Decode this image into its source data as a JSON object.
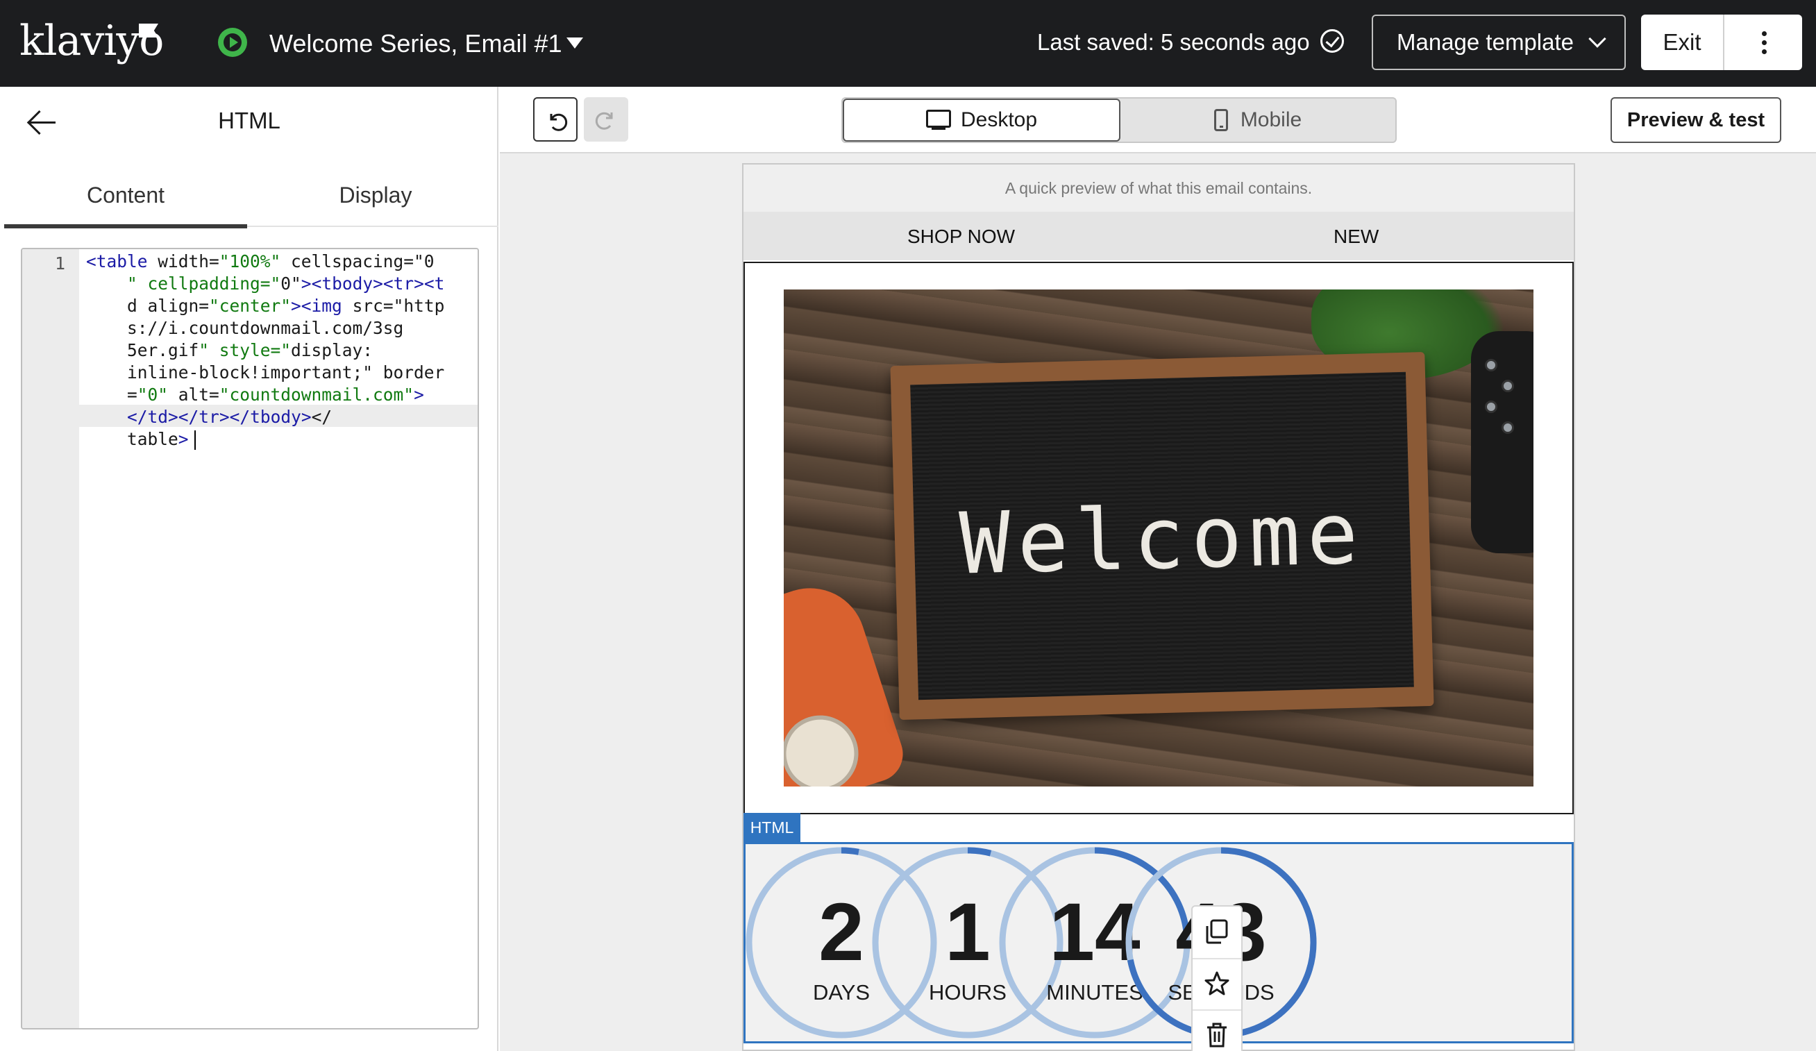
{
  "app": {
    "logo": "klaviyo",
    "brand_color": "#1c1d1f",
    "accent": "#2f74c0",
    "status_color": "#3fb54a"
  },
  "header": {
    "campaign_title": "Welcome Series, Email #1",
    "last_saved": "Last saved: 5 seconds ago",
    "manage_template_label": "Manage template",
    "exit_label": "Exit"
  },
  "left_panel": {
    "title": "HTML",
    "tabs": [
      {
        "label": "Content",
        "active": true
      },
      {
        "label": "Display",
        "active": false
      }
    ],
    "editor": {
      "line_number": "1",
      "code": "<table width=\"100%\" cellspacing=\"0\" cellpadding=\"0\"><tbody><tr><td align=\"center\"><img src=\"https://i.countdownmail.com/3sg5er.gif\" style=\"display:inline-block!important;\" border=\"0\" alt=\"countdownmail.com\"></td></tr></tbody></table>"
    }
  },
  "toolbar": {
    "undo_icon": "undo-icon",
    "redo_icon": "redo-icon",
    "device_options": [
      {
        "label": "Desktop",
        "icon": "monitor-icon",
        "selected": true
      },
      {
        "label": "Mobile",
        "icon": "phone-icon",
        "selected": false
      }
    ],
    "preview_label": "Preview & test"
  },
  "email": {
    "preheader": "A quick preview of what this email contains.",
    "nav_links": [
      "SHOP NOW",
      "NEW"
    ],
    "hero_text": "Welcome",
    "block_tag": "HTML",
    "countdown": [
      {
        "value": "2",
        "label": "DAYS",
        "progress": 0.03
      },
      {
        "value": "1",
        "label": "HOURS",
        "progress": 0.04
      },
      {
        "value": "14",
        "label": "MINUTES",
        "progress": 0.23
      },
      {
        "value": "43",
        "label": "SECONDS",
        "progress": 0.72
      }
    ]
  },
  "side_tools": [
    "duplicate-icon",
    "star-icon",
    "trash-icon"
  ]
}
